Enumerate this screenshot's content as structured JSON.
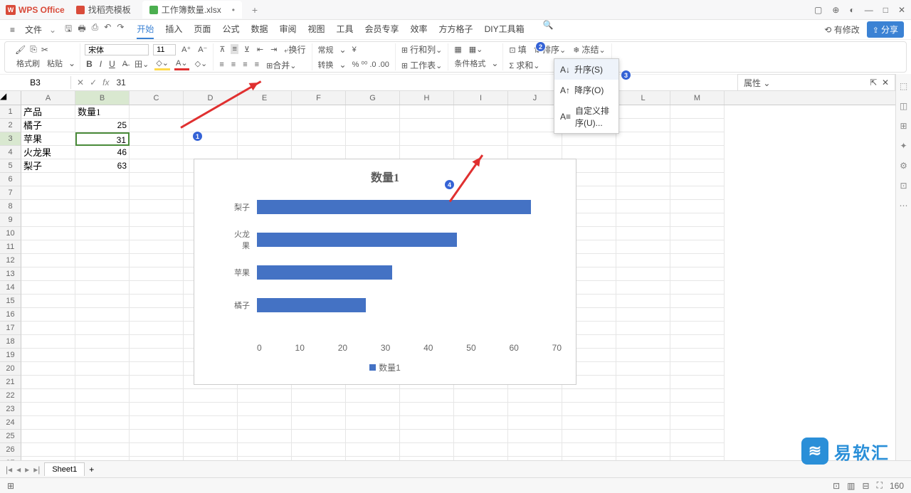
{
  "app": {
    "name": "WPS Office"
  },
  "tabs": [
    {
      "label": "找稻壳模板",
      "icon_color": "#d94b3a"
    },
    {
      "label": "工作簿数量.xlsx",
      "icon_color": "#4caf50",
      "active": true,
      "dirty": "•"
    }
  ],
  "menu": {
    "file": "文件",
    "items": [
      "开始",
      "插入",
      "页面",
      "公式",
      "数据",
      "审阅",
      "视图",
      "工具",
      "会员专享",
      "效率",
      "方方格子",
      "DIY工具箱"
    ],
    "active": "开始",
    "modify": "有修改",
    "share": "分享"
  },
  "ribbon": {
    "format_brush": "格式刷",
    "paste": "粘贴",
    "font_name": "宋体",
    "font_size": "11",
    "wrap": "换行",
    "merge": "合并",
    "general": "常规",
    "convert": "转换",
    "cond_format": "条件格式",
    "rowcol": "行和列",
    "worksheet": "工作表",
    "fill": "填",
    "sum": "求和",
    "sort": "排序",
    "freeze": "冻结"
  },
  "sort_menu": {
    "asc": "升序(S)",
    "desc": "降序(O)",
    "custom": "自定义排序(U)..."
  },
  "namebox": {
    "cell": "B3",
    "formula": "31"
  },
  "columns": [
    "A",
    "B",
    "C",
    "D",
    "E",
    "F",
    "G",
    "H",
    "I",
    "J",
    "K",
    "L",
    "M"
  ],
  "sheet_data": {
    "headers": {
      "col_a": "产品",
      "col_b": "数量1"
    },
    "rows": [
      {
        "a": "橘子",
        "b": "25"
      },
      {
        "a": "苹果",
        "b": "31"
      },
      {
        "a": "火龙果",
        "b": "46"
      },
      {
        "a": "梨子",
        "b": "63"
      }
    ]
  },
  "chart_data": {
    "type": "bar",
    "title": "数量1",
    "orientation": "horizontal",
    "categories": [
      "梨子",
      "火龙果",
      "苹果",
      "橘子"
    ],
    "values": [
      63,
      46,
      31,
      25
    ],
    "legend": "数量1",
    "x_ticks": [
      "0",
      "10",
      "20",
      "30",
      "40",
      "50",
      "60",
      "70"
    ],
    "xlim": [
      0,
      70
    ],
    "series_color": "#4472c4"
  },
  "properties_label": "属性",
  "sheet_tab": "Sheet1",
  "zoom": "160",
  "watermark": "易软汇",
  "markers": {
    "m1": "1",
    "m2": "2",
    "m3": "3",
    "m4": "4"
  }
}
